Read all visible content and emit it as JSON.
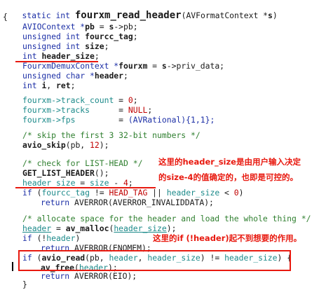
{
  "code": {
    "l01": {
      "t1": "static int ",
      "fn": "fourxm_read_header",
      "t2": "(AVFormatContext *",
      "p": "s",
      "t3": ")"
    },
    "l02": "{",
    "l03": {
      "a": "AVIOContext *",
      "b": "pb",
      "c": " = ",
      "d": "s",
      "e": "->pb;"
    },
    "l04": {
      "a": "unsigned int ",
      "b": "fourcc_tag",
      "c": ";"
    },
    "l05": {
      "a": "unsigned int ",
      "b": "size",
      "c": ";"
    },
    "l06": {
      "a": "int ",
      "b": "header_size",
      "c": ";"
    },
    "l07": {
      "a": "FourxmDemuxContext *",
      "b": "fourxm",
      "c": " = ",
      "d": "s",
      "e": "->priv_data;"
    },
    "l08": {
      "a": "unsigned char *",
      "b": "header",
      "c": ";"
    },
    "l09": {
      "a": "int ",
      "b": "i",
      "c": ", ",
      "d": "ret",
      "e": ";"
    },
    "l10": {
      "a": "fourxm->track_count ",
      "b": "= ",
      "c": "0",
      "d": ";"
    },
    "l11": {
      "a": "fourxm->tracks      ",
      "b": "= ",
      "c": "NULL",
      "d": ";"
    },
    "l12": {
      "a": "fourxm->fps         ",
      "b": "= ",
      "c": "(AVRational){1,1};"
    },
    "l13": "/* skip the first 3 32-bit numbers */",
    "l14": {
      "a": "avio_skip",
      "b": "(pb, ",
      "c": "12",
      "d": ");"
    },
    "l15": "/* check for LIST-HEAD */",
    "l16": {
      "a": "GET_LIST_HEADER",
      "b": "();"
    },
    "l17": {
      "a": "header_size",
      "b": " = ",
      "c": "size",
      "d": " - ",
      "e": "4",
      "f": ";"
    },
    "l18": {
      "a": "if",
      "b": " (",
      "c": "fourcc_tag",
      "d": " != ",
      "e": "HEAD_TAG",
      "f": " || ",
      "g": "header_size",
      "h": " < ",
      "i": "0",
      "j": ")"
    },
    "l19": {
      "a": "return ",
      "b": "AVERROR(",
      "c": "AVERROR_INVALIDDATA",
      "d": ");"
    },
    "l20": "/* allocate space for the header and load the whole thing */",
    "l21": {
      "a": "header",
      "b": " = ",
      "c": "av_malloc",
      "d": "(",
      "e": "header_size",
      "f": ");"
    },
    "l22": {
      "a": "if",
      "b": " (!",
      "c": "header",
      "d": ")"
    },
    "l23": {
      "a": "return ",
      "b": "AVERROR(ENOMEM);"
    },
    "l24": {
      "a": "if",
      "b": " (",
      "c": "avio_read",
      "d": "(pb, ",
      "e": "header",
      "f": ", ",
      "g": "header_size",
      "h": ") != ",
      "i": "header_size",
      "j": ") {"
    },
    "l25": {
      "a": "av_free",
      "b": "(",
      "c": "header",
      "d": ");"
    },
    "l26": {
      "a": "return ",
      "b": "AVERROR(EIO);"
    },
    "l27": "}"
  },
  "annotations": {
    "note1_line1": "这里的header_size是由用户输入决定",
    "note1_line2": "的size-4的值确定的，也即是可控的。",
    "note2": "这里的if (!header)起不到想要的作用。"
  },
  "colors": {
    "annotation": "#e8190f",
    "keyword": "#1c2fa6",
    "comment": "#2f7f2f",
    "macro": "#c00000"
  }
}
